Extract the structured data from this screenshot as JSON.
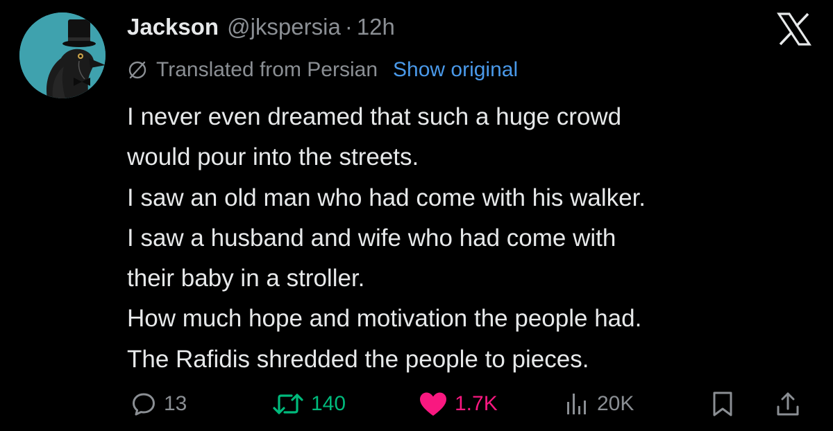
{
  "author": {
    "name": "Jackson",
    "handle": "@jkspersia",
    "separator": "·",
    "time": "12h",
    "avatar_icon": "top-hat-crow-avatar"
  },
  "brand": {
    "logo_icon": "x-logo-icon"
  },
  "translation": {
    "label": "Translated from Persian",
    "show_original": "Show original",
    "icon": "translate-globe-icon"
  },
  "tweet": {
    "lines": [
      "I never even dreamed that such a huge crowd",
      "would pour into the streets.",
      "I saw an old man who had come with his walker.",
      "I saw a husband and wife who had come with",
      "their baby in a stroller.",
      "How much hope and motivation the people had.",
      "The Rafidis shredded the people to pieces."
    ]
  },
  "actions": {
    "replies": "13",
    "reposts": "140",
    "likes": "1.7K",
    "views": "20K"
  },
  "colors": {
    "background": "#000000",
    "text": "#e7e9ea",
    "muted": "#8b8f94",
    "link": "#4a99e9",
    "repost": "#00ba7c",
    "like": "#f91880",
    "avatar_bg": "#3fa2ae"
  }
}
